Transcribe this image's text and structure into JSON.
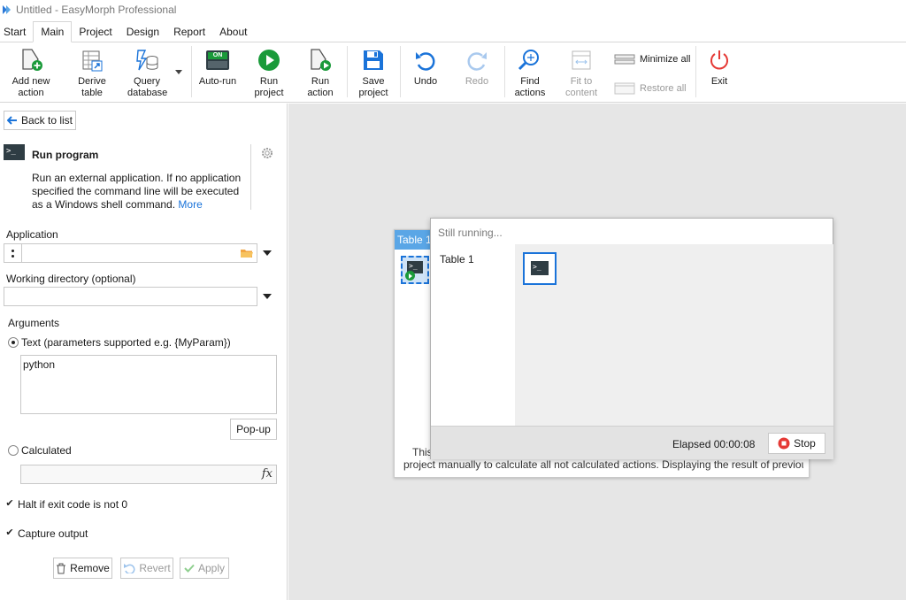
{
  "app": {
    "title": "Untitled - EasyMorph Professional"
  },
  "menu": [
    {
      "label": "Start",
      "active": false
    },
    {
      "label": "Main",
      "active": true
    },
    {
      "label": "Project",
      "active": false
    },
    {
      "label": "Design",
      "active": false
    },
    {
      "label": "Report",
      "active": false
    },
    {
      "label": "About",
      "active": false
    }
  ],
  "ribbon": {
    "add_new_action": "Add new\naction",
    "derive_table": "Derive\ntable",
    "query_database": "Query\ndatabase",
    "auto_run": "Auto-run",
    "auto_run_badge": "ON",
    "run_project": "Run\nproject",
    "run_action": "Run\naction",
    "save_project": "Save\nproject",
    "undo": "Undo",
    "redo": "Redo",
    "find_actions": "Find\nactions",
    "fit_to_content": "Fit to\ncontent",
    "minimize_all": "Minimize all",
    "restore_all": "Restore all",
    "exit": "Exit"
  },
  "panel": {
    "back_to_list": "Back to list",
    "action_title": "Run program",
    "action_desc": "Run an external application. If no application specified the command line will be executed as a Windows shell command.",
    "more_link": "More",
    "application_label": "Application",
    "application_value": "",
    "working_dir_label": "Working directory (optional)",
    "working_dir_value": "",
    "arguments_label": "Arguments",
    "text_option": "Text (parameters supported e.g. {MyParam})",
    "text_value": "python",
    "popup_button": "Pop-up",
    "calculated_option": "Calculated",
    "calculated_value": "",
    "fx": "fx",
    "halt_label": "Halt if exit code is not 0",
    "capture_label": "Capture output",
    "remove_button": "Remove",
    "revert_button": "Revert",
    "apply_button": "Apply"
  },
  "workspace": {
    "table_title": "Table 1",
    "table_message_1": "This",
    "table_message_2": "project manually to calculate all not calculated actions. Displaying the result of previous...",
    "run_status": "Still running...",
    "run_table_name": "Table 1",
    "elapsed": "Elapsed 00:00:08",
    "stop_button": "Stop"
  },
  "colors": {
    "accent": "#1a73d9",
    "run_green": "#1a9a3a",
    "exit_red": "#e53935",
    "stop_red": "#e53935",
    "table_header": "#5aa6e6"
  }
}
